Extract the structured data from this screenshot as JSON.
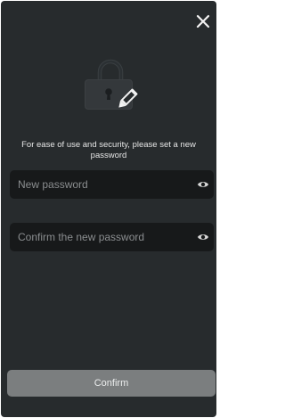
{
  "header": {
    "close_icon": "close-icon"
  },
  "illustration": {
    "icon": "lock-edit-icon"
  },
  "message": "For ease of use and security, please set a new password",
  "form": {
    "new_password": {
      "placeholder": "New password",
      "value": "",
      "toggle_icon": "eye-icon"
    },
    "confirm_password": {
      "placeholder": "Confirm the new password",
      "value": "",
      "toggle_icon": "eye-icon"
    }
  },
  "confirm_button_label": "Confirm",
  "colors": {
    "background": "#272b2d",
    "field_background": "#17191a",
    "button_background": "#7b7e7f",
    "text": "#e6e6e6",
    "placeholder": "#8a8d8f"
  }
}
